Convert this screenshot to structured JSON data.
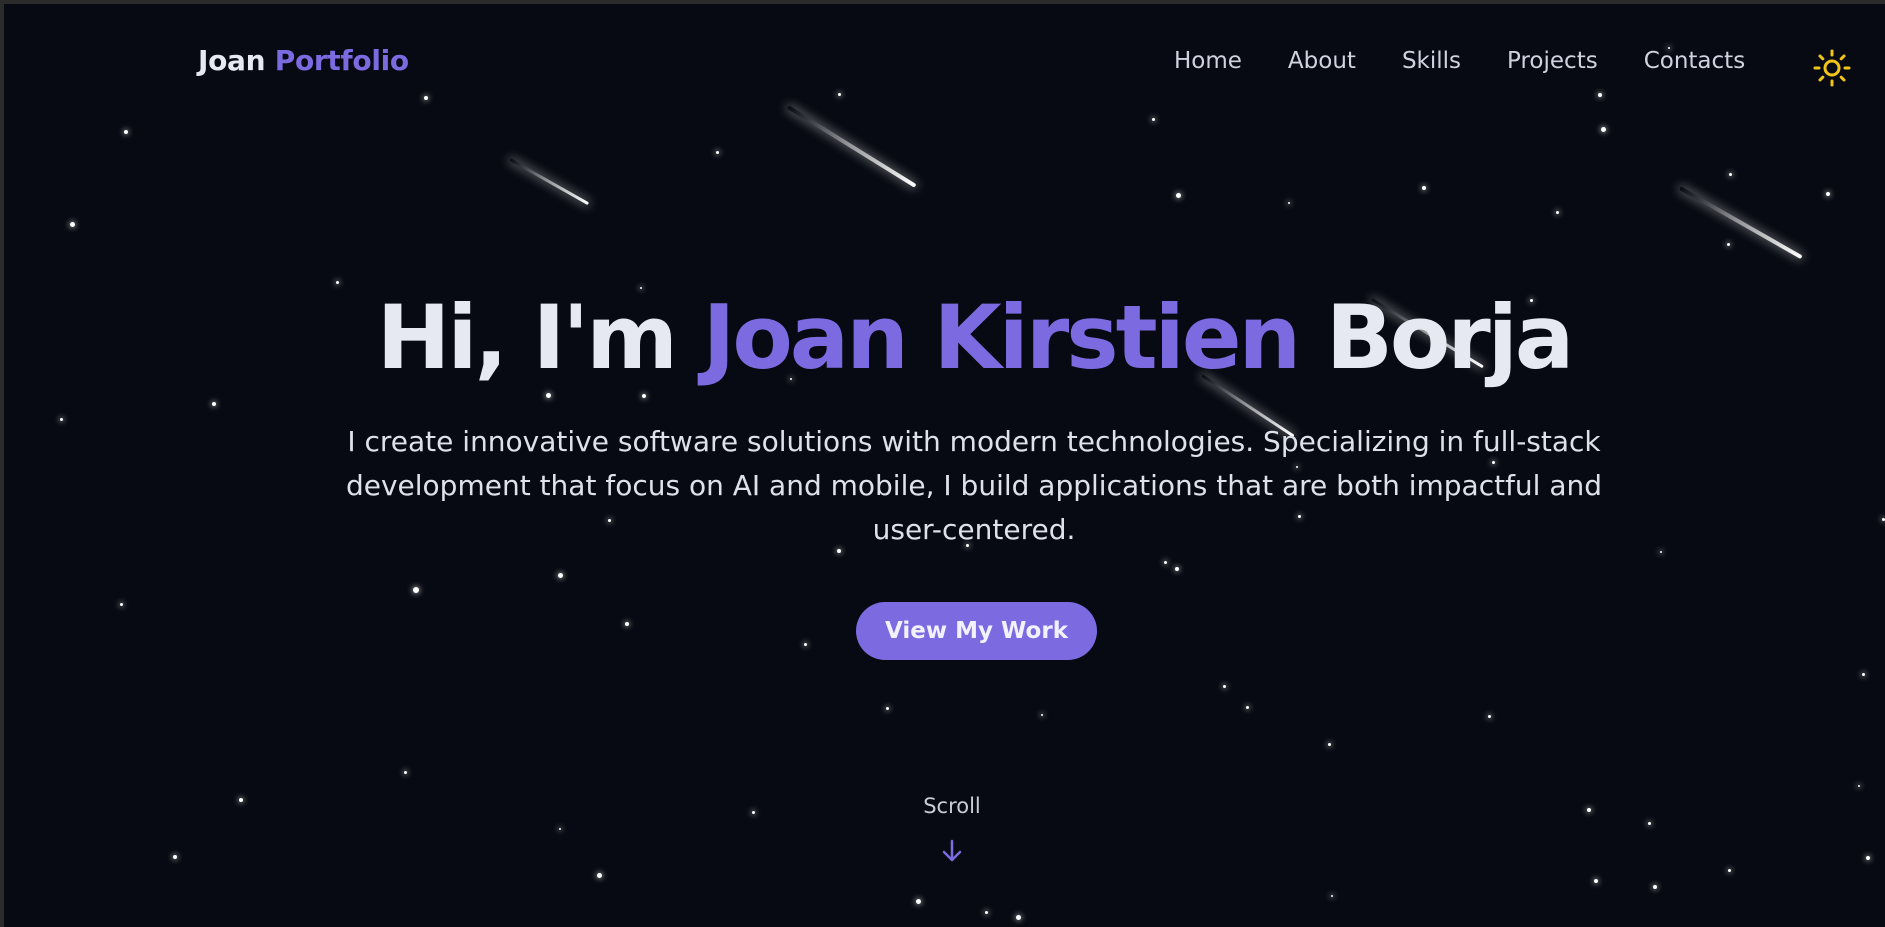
{
  "brand": {
    "first": "Joan",
    "second": "Portfolio"
  },
  "nav": {
    "items": [
      "Home",
      "About",
      "Skills",
      "Projects",
      "Contacts"
    ],
    "theme_toggle_icon": "sun-icon"
  },
  "hero": {
    "greeting": "Hi, I'm",
    "name_highlight": "Joan Kirstien",
    "name_rest": "Borja",
    "subtitle": "I create innovative software solutions with modern technologies. Specializing in full-stack development that focus on AI and mobile, I build applications that are both impactful and user-centered.",
    "cta_label": "View My Work"
  },
  "scroll": {
    "label": "Scroll",
    "icon": "arrow-down-icon"
  },
  "colors": {
    "background": "#070a12",
    "accent": "#7c6be0",
    "text": "#e6e9f2",
    "sun": "#f2c418"
  }
}
